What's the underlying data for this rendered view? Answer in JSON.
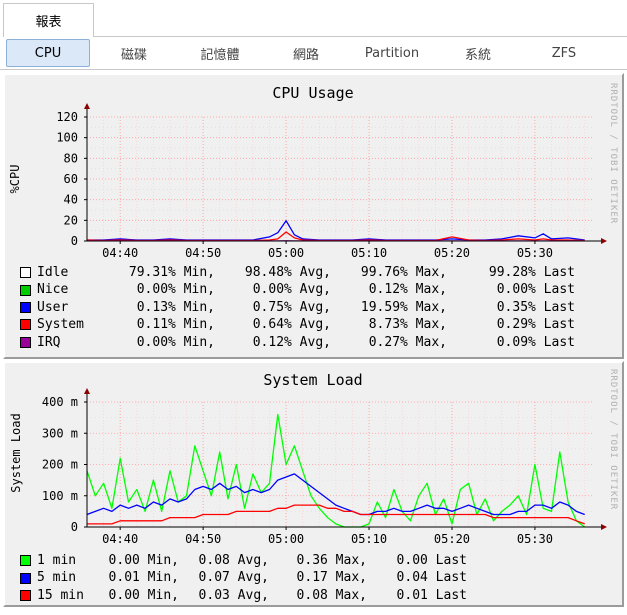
{
  "top_tab": {
    "label": "報表"
  },
  "subnav": {
    "items": [
      {
        "label": "CPU",
        "active": true
      },
      {
        "label": "磁碟",
        "active": false
      },
      {
        "label": "記憶體",
        "active": false
      },
      {
        "label": "網路",
        "active": false
      },
      {
        "label": "Partition",
        "active": false
      },
      {
        "label": "系統",
        "active": false
      },
      {
        "label": "ZFS",
        "active": false
      }
    ]
  },
  "watermark": "RRDTOOL / TOBI OETIKER",
  "colors": {
    "idle": "#ffffff",
    "nice": "#00cc00",
    "user": "#0000ff",
    "system": "#ff0000",
    "irq": "#990099",
    "load_1": "#00ff00",
    "load_5": "#0000ff",
    "load_15": "#ff0000",
    "grid": "#ffb0b0",
    "panel_bg": "#f0f0f0"
  },
  "cpu_graph": {
    "title": "CPU Usage",
    "ylabel": "%CPU",
    "legend": [
      {
        "name": "Idle",
        "color_key": "idle",
        "min": "79.31% Min,",
        "avg": "98.48% Avg,",
        "max": "99.76% Max,",
        "last": "99.28% Last"
      },
      {
        "name": "Nice",
        "color_key": "nice",
        "min": "0.00% Min,",
        "avg": "0.00% Avg,",
        "max": "0.12% Max,",
        "last": "0.00% Last"
      },
      {
        "name": "User",
        "color_key": "user",
        "min": "0.13% Min,",
        "avg": "0.75% Avg,",
        "max": "19.59% Max,",
        "last": "0.35% Last"
      },
      {
        "name": "System",
        "color_key": "system",
        "min": "0.11% Min,",
        "avg": "0.64% Avg,",
        "max": "8.73% Max,",
        "last": "0.29% Last"
      },
      {
        "name": "IRQ",
        "color_key": "irq",
        "min": "0.00% Min,",
        "avg": "0.12% Avg,",
        "max": "0.27% Max,",
        "last": "0.09% Last"
      }
    ]
  },
  "load_graph": {
    "title": "System Load",
    "ylabel": "System Load",
    "legend": [
      {
        "name": "1 min",
        "color_key": "load_1",
        "min": "0.00 Min,",
        "avg": "0.08 Avg,",
        "max": "0.36 Max,",
        "last": "0.00 Last"
      },
      {
        "name": "5 min",
        "color_key": "load_5",
        "min": "0.01 Min,",
        "avg": "0.07 Avg,",
        "max": "0.17 Max,",
        "last": "0.04 Last"
      },
      {
        "name": "15 min",
        "color_key": "load_15",
        "min": "0.00 Min,",
        "avg": "0.03 Avg,",
        "max": "0.08 Max,",
        "last": "0.01 Last"
      }
    ]
  },
  "chart_data": [
    {
      "type": "line",
      "title": "CPU Usage",
      "ylabel": "%CPU",
      "ylim": [
        0,
        120
      ],
      "yticks": [
        "0",
        "20",
        "40",
        "60",
        "80",
        "100",
        "120"
      ],
      "xticks": [
        "04:40",
        "04:50",
        "05:00",
        "05:10",
        "05:20",
        "05:30"
      ],
      "xlim": [
        "04:36",
        "05:37"
      ],
      "grid": true,
      "legend_position": "bottom",
      "x": [
        "04:36",
        "04:38",
        "04:40",
        "04:42",
        "04:44",
        "04:46",
        "04:48",
        "04:50",
        "04:52",
        "04:54",
        "04:56",
        "04:58",
        "04:59",
        "05:00",
        "05:01",
        "05:02",
        "05:04",
        "05:06",
        "05:08",
        "05:10",
        "05:12",
        "05:14",
        "05:16",
        "05:18",
        "05:20",
        "05:22",
        "05:24",
        "05:26",
        "05:28",
        "05:30",
        "05:31",
        "05:32",
        "05:34",
        "05:36"
      ],
      "series": [
        {
          "name": "User",
          "values": [
            1,
            1,
            2,
            1,
            1,
            2,
            1,
            1,
            1,
            1,
            1,
            4,
            8,
            19.6,
            6,
            2,
            1,
            1,
            1,
            2,
            1,
            1,
            1,
            1,
            2,
            1,
            1,
            2,
            5,
            3,
            7,
            2,
            3,
            1
          ]
        },
        {
          "name": "System",
          "values": [
            1,
            0.5,
            1,
            0.5,
            0.5,
            1,
            0.5,
            0.5,
            0.5,
            0.5,
            0.5,
            1,
            2,
            8.7,
            3,
            1,
            0.5,
            0.5,
            0.5,
            1,
            0.5,
            0.5,
            0.5,
            0.5,
            4,
            1,
            0.5,
            1,
            2,
            1,
            2,
            1,
            1,
            0.5
          ]
        },
        {
          "name": "IRQ",
          "values": [
            0.1,
            0.1,
            0.1,
            0.1,
            0.1,
            0.1,
            0.1,
            0.1,
            0.1,
            0.1,
            0.1,
            0.1,
            0.1,
            0.2,
            0.1,
            0.1,
            0.1,
            0.1,
            0.1,
            0.1,
            0.1,
            0.1,
            0.1,
            0.1,
            0.1,
            0.1,
            0.1,
            0.1,
            0.1,
            0.1,
            0.1,
            0.1,
            0.1,
            0.1
          ]
        }
      ]
    },
    {
      "type": "line",
      "title": "System Load",
      "ylabel": "System Load",
      "ylim": [
        0,
        0.4
      ],
      "yticks": [
        "0",
        "100 m",
        "200 m",
        "300 m",
        "400 m"
      ],
      "xticks": [
        "04:40",
        "04:50",
        "05:00",
        "05:10",
        "05:20",
        "05:30"
      ],
      "xlim": [
        "04:36",
        "05:37"
      ],
      "grid": true,
      "legend_position": "bottom",
      "x": [
        "04:36",
        "04:37",
        "04:38",
        "04:39",
        "04:40",
        "04:41",
        "04:42",
        "04:43",
        "04:44",
        "04:45",
        "04:46",
        "04:47",
        "04:48",
        "04:49",
        "04:50",
        "04:51",
        "04:52",
        "04:53",
        "04:54",
        "04:55",
        "04:56",
        "04:57",
        "04:58",
        "04:59",
        "05:00",
        "05:01",
        "05:02",
        "05:03",
        "05:04",
        "05:05",
        "05:06",
        "05:07",
        "05:08",
        "05:09",
        "05:10",
        "05:11",
        "05:12",
        "05:13",
        "05:14",
        "05:15",
        "05:16",
        "05:17",
        "05:18",
        "05:19",
        "05:20",
        "05:21",
        "05:22",
        "05:23",
        "05:24",
        "05:25",
        "05:26",
        "05:27",
        "05:28",
        "05:29",
        "05:30",
        "05:31",
        "05:32",
        "05:33",
        "05:34",
        "05:35",
        "05:36"
      ],
      "series": [
        {
          "name": "1 min",
          "values": [
            0.18,
            0.1,
            0.14,
            0.06,
            0.22,
            0.08,
            0.12,
            0.05,
            0.15,
            0.05,
            0.18,
            0.08,
            0.1,
            0.26,
            0.18,
            0.1,
            0.24,
            0.09,
            0.2,
            0.06,
            0.17,
            0.11,
            0.14,
            0.36,
            0.2,
            0.26,
            0.18,
            0.1,
            0.06,
            0.03,
            0.01,
            0.0,
            0.0,
            0.0,
            0.01,
            0.08,
            0.03,
            0.12,
            0.05,
            0.02,
            0.1,
            0.14,
            0.04,
            0.09,
            0.01,
            0.12,
            0.14,
            0.04,
            0.09,
            0.02,
            0.05,
            0.07,
            0.1,
            0.04,
            0.2,
            0.06,
            0.05,
            0.24,
            0.08,
            0.02,
            0.0
          ]
        },
        {
          "name": "5 min",
          "values": [
            0.04,
            0.05,
            0.06,
            0.05,
            0.07,
            0.06,
            0.07,
            0.06,
            0.08,
            0.07,
            0.09,
            0.08,
            0.09,
            0.12,
            0.13,
            0.12,
            0.14,
            0.12,
            0.13,
            0.11,
            0.12,
            0.11,
            0.12,
            0.15,
            0.16,
            0.17,
            0.15,
            0.13,
            0.11,
            0.09,
            0.07,
            0.06,
            0.05,
            0.04,
            0.04,
            0.05,
            0.05,
            0.06,
            0.05,
            0.05,
            0.06,
            0.07,
            0.06,
            0.06,
            0.05,
            0.06,
            0.07,
            0.06,
            0.05,
            0.04,
            0.04,
            0.04,
            0.05,
            0.05,
            0.07,
            0.07,
            0.06,
            0.08,
            0.07,
            0.05,
            0.04
          ]
        },
        {
          "name": "15 min",
          "values": [
            0.01,
            0.01,
            0.01,
            0.01,
            0.02,
            0.02,
            0.02,
            0.02,
            0.02,
            0.02,
            0.03,
            0.03,
            0.03,
            0.03,
            0.04,
            0.04,
            0.04,
            0.04,
            0.05,
            0.05,
            0.05,
            0.05,
            0.05,
            0.06,
            0.06,
            0.07,
            0.07,
            0.07,
            0.07,
            0.06,
            0.06,
            0.05,
            0.05,
            0.04,
            0.04,
            0.04,
            0.04,
            0.04,
            0.04,
            0.04,
            0.04,
            0.04,
            0.04,
            0.04,
            0.04,
            0.04,
            0.04,
            0.04,
            0.04,
            0.03,
            0.03,
            0.03,
            0.03,
            0.03,
            0.03,
            0.03,
            0.03,
            0.03,
            0.03,
            0.02,
            0.01
          ]
        }
      ]
    }
  ]
}
